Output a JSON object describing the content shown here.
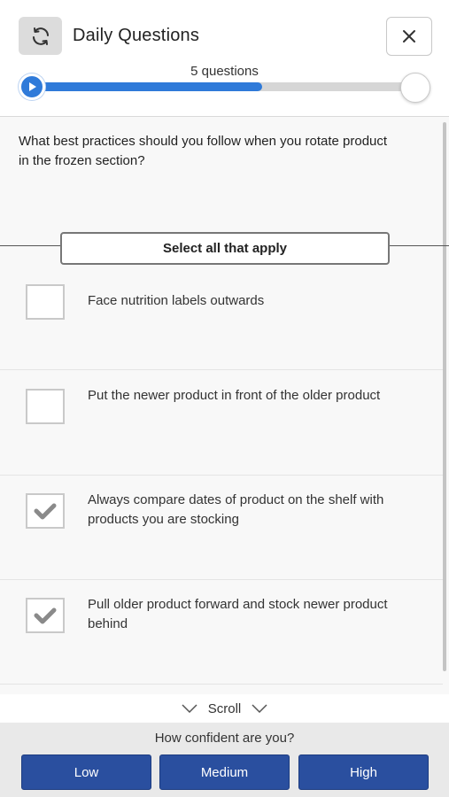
{
  "header": {
    "title": "Daily Questions",
    "progress_label": "5 questions",
    "progress_fraction": 0.6
  },
  "question": {
    "text": "What best practices should you follow when you rotate product in the frozen section?",
    "instruction": "Select all that apply"
  },
  "options": [
    {
      "label": "Face nutrition labels outwards",
      "checked": false
    },
    {
      "label": "Put the newer product in front of the older product",
      "checked": false
    },
    {
      "label": "Always compare dates of product on the shelf with products you are stocking",
      "checked": true
    },
    {
      "label": "Pull older product forward and stock newer product behind",
      "checked": true
    }
  ],
  "scroll_hint": "Scroll",
  "confidence": {
    "prompt": "How confident are you?",
    "low": "Low",
    "medium": "Medium",
    "high": "High"
  },
  "colors": {
    "accent": "#2f7ad9",
    "button": "#2a4f9f"
  }
}
